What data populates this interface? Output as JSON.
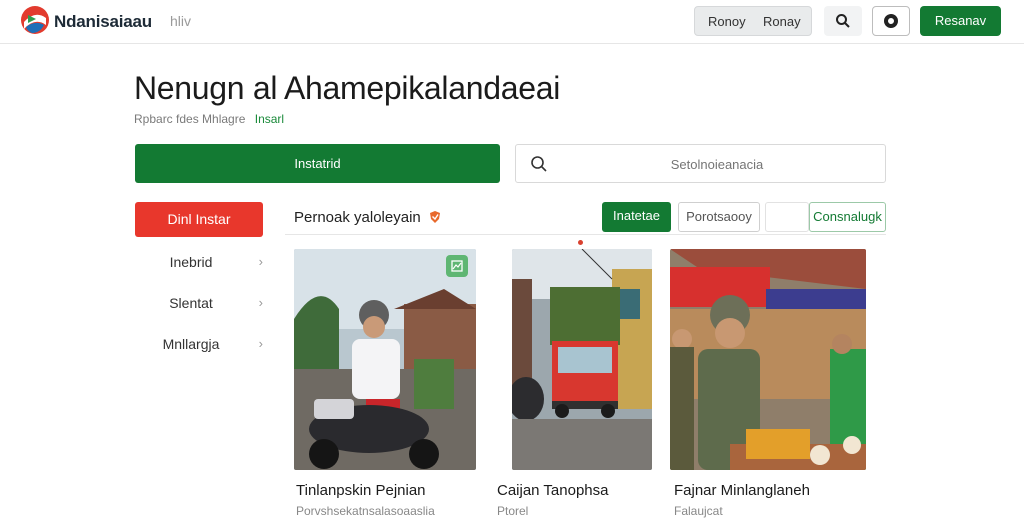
{
  "header": {
    "brand": "Ndanisaiaau",
    "nav_link": "hliv",
    "segment": [
      "Ronoy",
      "Ronay"
    ],
    "cta": "Resanav"
  },
  "page": {
    "title": "Nenugn al Ahamepikalandaeai",
    "subtitle": "Rpbarc fdes Mhlagre",
    "subtitle_accent": "Insarl"
  },
  "actions": {
    "primary": "Instatrid",
    "search_placeholder": "Setolnoieanacia"
  },
  "sidebar": {
    "primary": "Dinl Instar",
    "items": [
      {
        "label": "Inebrid"
      },
      {
        "label": "Slentat"
      },
      {
        "label": "Mnllargja"
      }
    ]
  },
  "feed": {
    "title": "Pernoak yaloleyain",
    "filters": {
      "green": "Inatetae",
      "outline": "Porotsaooy",
      "outline_green": "Consnalugk"
    },
    "cards": [
      {
        "title": "Tinlanpskin Pejnian",
        "sub": "Porvshsekatnsalasoaaslia"
      },
      {
        "title": "Caijan Tanophsa",
        "sub": "Ptorel"
      },
      {
        "title": "Fajnar Minlanglaneh",
        "sub": "Falaujcat"
      }
    ]
  },
  "colors": {
    "brand_green": "#137a33",
    "alert_red": "#e8372c"
  }
}
